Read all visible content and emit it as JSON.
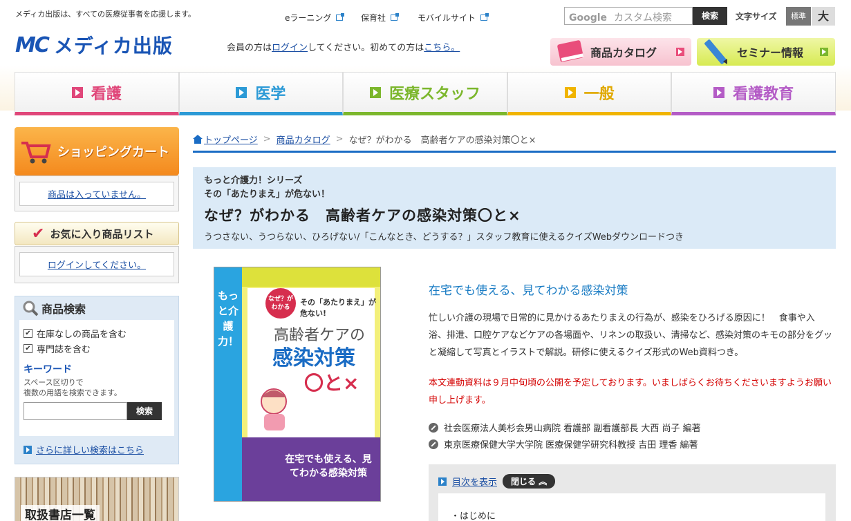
{
  "header": {
    "tagline": "メディカ出版は、すべての医療従事者を応援します。",
    "links": [
      "eラーニング",
      "保育社",
      "モバイルサイト"
    ],
    "search_placeholder": "カスタム検索",
    "search_brand": "Google",
    "search_button": "検索",
    "fontsize_label": "文字サイズ",
    "fontsize_normal": "標準",
    "fontsize_large": "大",
    "logo_mark": "MC",
    "logo_text": "メディカ出版",
    "member_prefix": "会員の方は",
    "member_login": "ログイン",
    "member_middle": "してください。初めての方は",
    "member_here": "こちら。",
    "catalog_button": "商品カタログ",
    "seminar_button": "セミナー情報"
  },
  "nav": [
    {
      "label": "看護",
      "color": "#e0477a"
    },
    {
      "label": "医学",
      "color": "#2c9ad6"
    },
    {
      "label": "医療スタッフ",
      "color": "#7cb72d"
    },
    {
      "label": "一般",
      "color": "#f0b400"
    },
    {
      "label": "看護教育",
      "color": "#b45cc6"
    }
  ],
  "sidebar": {
    "cart_title": "ショッピングカート",
    "cart_empty": "商品は入っていません。",
    "fav_title": "お気に入り商品リスト",
    "fav_login": "ログインしてください。",
    "search_title": "商品検索",
    "chk_stock": "在庫なしの商品を含む",
    "chk_journal": "専門誌を含む",
    "keyword_title": "キーワード",
    "keyword_desc1": "スペース区切りで",
    "keyword_desc2": "複数の用語を検索できます。",
    "keyword_button": "検索",
    "advanced_link": "さらに詳しい検索はこちら",
    "stores_title": "取扱書店一覧"
  },
  "breadcrumb": {
    "home": "トップページ",
    "catalog": "商品カタログ",
    "current": "なぜ？がわかる　高齢者ケアの感染対策〇と×"
  },
  "product": {
    "series": "もっと介護力！シリーズ",
    "series_sub": "その「あたりまえ」が危ない！",
    "title": "なぜ？がわかる　高齢者ケアの感染対策〇と×",
    "subtitle": "うつさない、うつらない、ひろげない/「こんなとき、どうする？」スタッフ教育に使えるクイズWebダウンロードつき",
    "catch": "在宅でも使える、見てわかる感染対策",
    "description": "忙しい介護の現場で日常的に見かけるあたりまえの行為が、感染をひろげる原因に！　食事や入浴、排泄、口腔ケアなどケアの各場面や、リネンの取扱い、清掃など、感染対策のキモの部分をグッと凝縮して写真とイラストで解説。研修に使えるクイズ形式のWeb資料つき。",
    "notice": "本文連動資料は９月中旬頃の公開を予定しております。いましばらくお待ちくださいますようお願い申し上げます。",
    "authors": [
      "社会医療法人美杉会男山病院 看護部 副看護部長 大西 尚子 編著",
      "東京医療保健大学大学院 医療保健学研究科教授 吉田 理香 編著"
    ],
    "toc_link": "目次を表示",
    "toc_close": "閉じる",
    "toc_first": "・はじめに"
  },
  "cover": {
    "badge": "なぜ？がわかる",
    "series_vertical": "もっと介護力！",
    "line1": "その「あたりまえ」が危ない!",
    "line2": "高齢者ケアの",
    "line3": "感染対策",
    "line4": "〇と×",
    "line5": "在宅でも使える、見てわかる感染対策"
  }
}
